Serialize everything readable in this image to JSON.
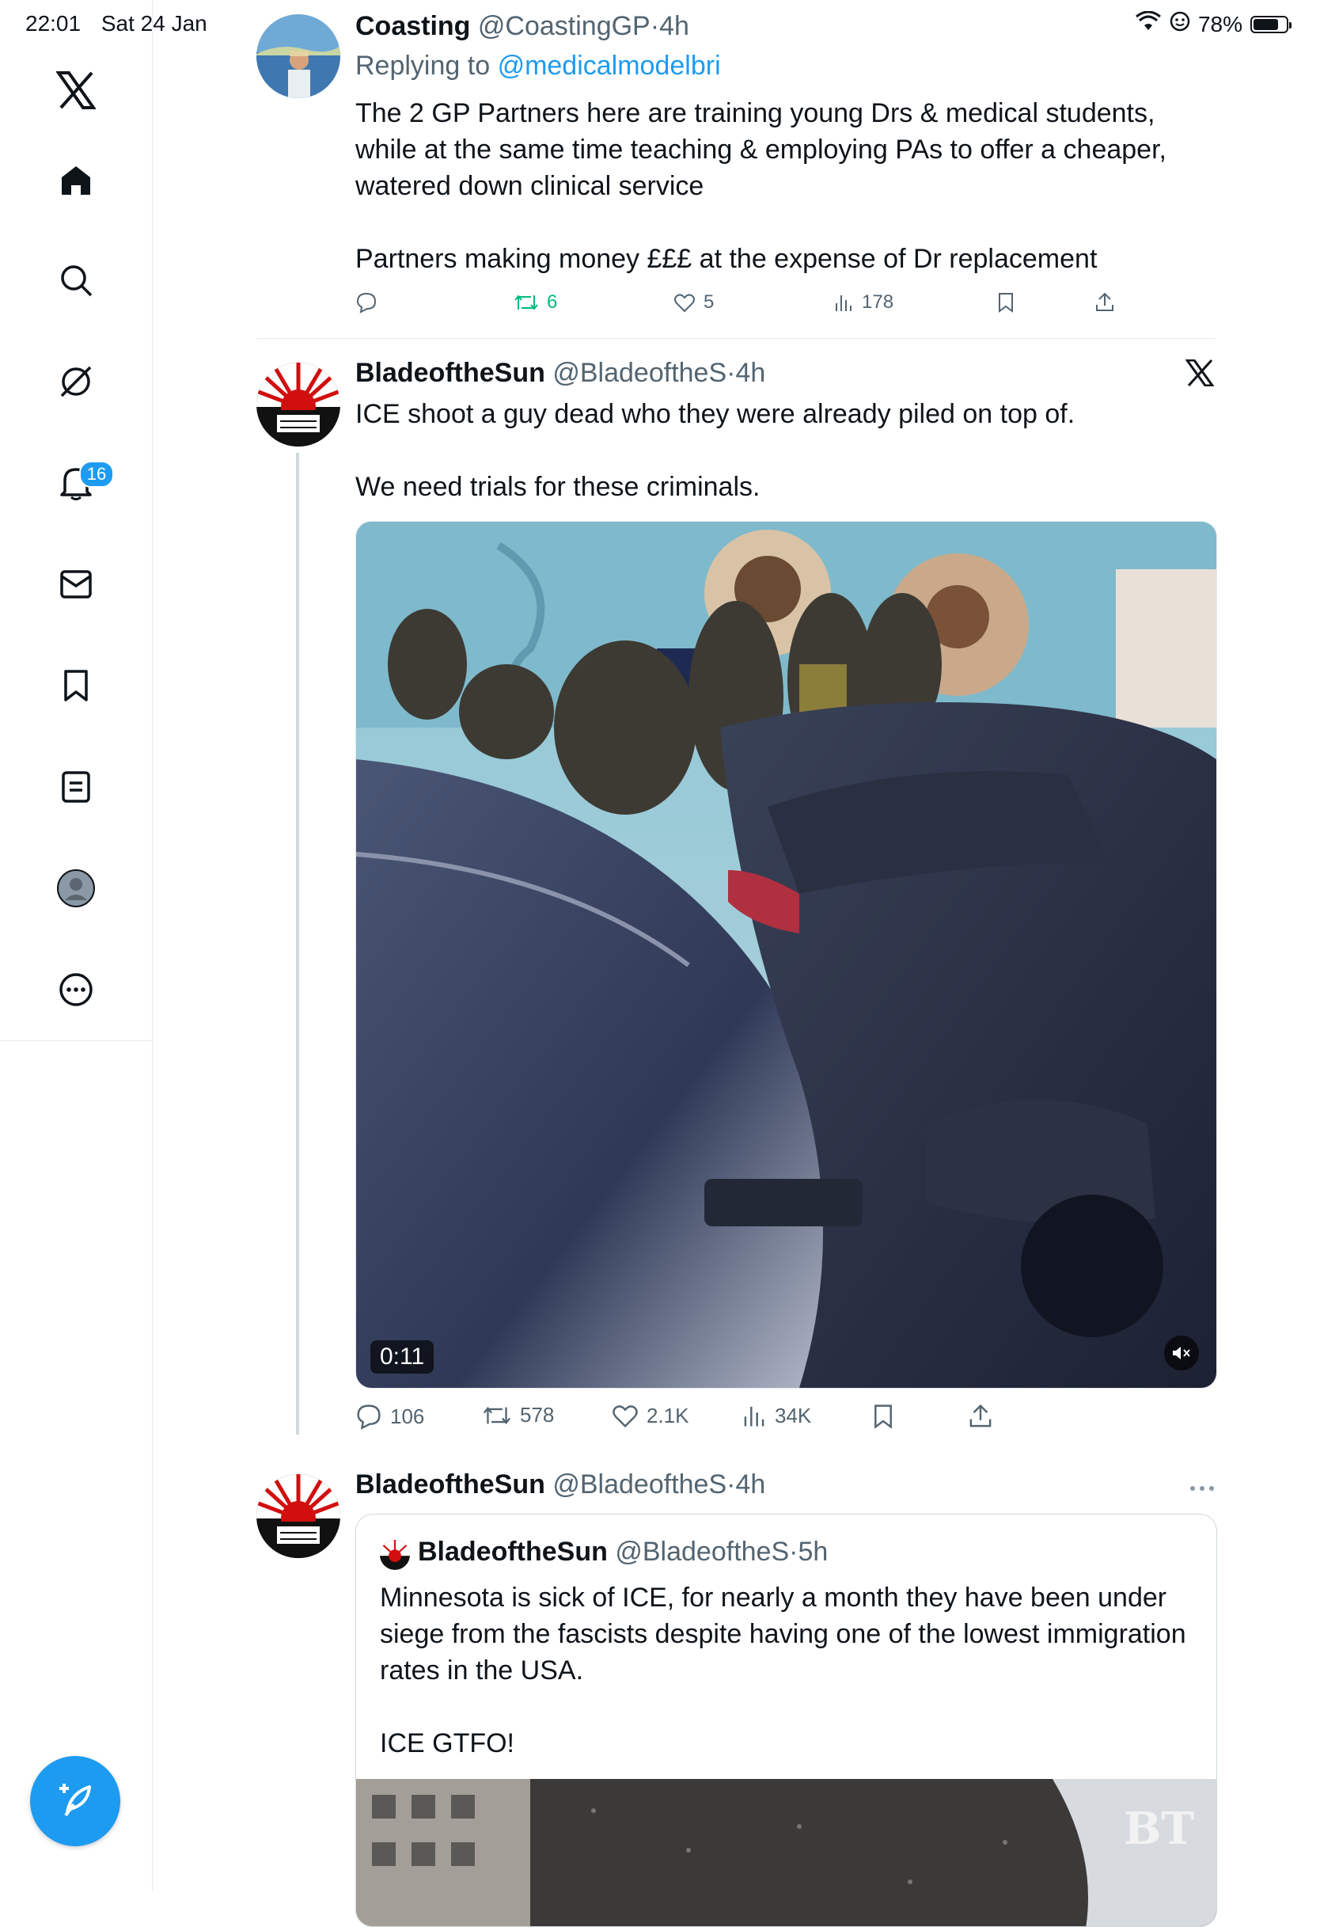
{
  "status_bar": {
    "time": "22:01",
    "date": "Sat 24 Jan",
    "battery_text": "78%",
    "battery_level": 0.78
  },
  "sidebar": {
    "items": [
      {
        "icon": "x-logo-icon"
      },
      {
        "icon": "home-icon"
      },
      {
        "icon": "search-icon"
      },
      {
        "icon": "grok-icon"
      },
      {
        "icon": "notifications-icon",
        "badge": "16"
      },
      {
        "icon": "messages-icon"
      },
      {
        "icon": "bookmarks-icon"
      },
      {
        "icon": "lists-icon"
      },
      {
        "icon": "profile-icon"
      },
      {
        "icon": "more-icon"
      }
    ],
    "compose_icon": "compose-post-icon"
  },
  "tweets": [
    {
      "name": "Coasting",
      "handle": "@CoastingGP",
      "dot": "·",
      "time": "4h",
      "replying_label": "Replying to",
      "replying_handle": "@medicalmodelbri",
      "text": "The 2 GP Partners here are training young Drs & medical students, while at the same time teaching & employing PAs to offer a cheaper, watered down clinical service\n\nPartners making money £££ at the expense of Dr replacement",
      "stats": {
        "replies": "",
        "reposts": "6",
        "likes": "5",
        "views": "178"
      }
    },
    {
      "name": "BladeoftheSun",
      "handle": "@BladeoftheS",
      "dot": "·",
      "time": "4h",
      "text": "ICE shoot a guy dead who they were already piled on top of.\n\nWe need trials for these criminals.",
      "media_duration": "0:11",
      "stats": {
        "replies": "106",
        "reposts": "578",
        "likes": "2.1K",
        "views": "34K"
      }
    },
    {
      "name": "BladeoftheSun",
      "handle": "@BladeoftheS",
      "dot": "·",
      "time": "4h",
      "quote": {
        "name": "BladeoftheSun",
        "handle": "@BladeoftheS",
        "dot": "·",
        "time": "5h",
        "text": "Minnesota is sick of ICE, for nearly a month they have been under siege from the fascists despite having one of the lowest immigration rates in the USA.\n\nICE GTFO!",
        "media_watermark": "BT"
      }
    }
  ],
  "colors": {
    "accent": "#1d9bf0",
    "repost_active": "#00ba7c",
    "muted_text": "#536471",
    "border": "#e6e9ec"
  }
}
